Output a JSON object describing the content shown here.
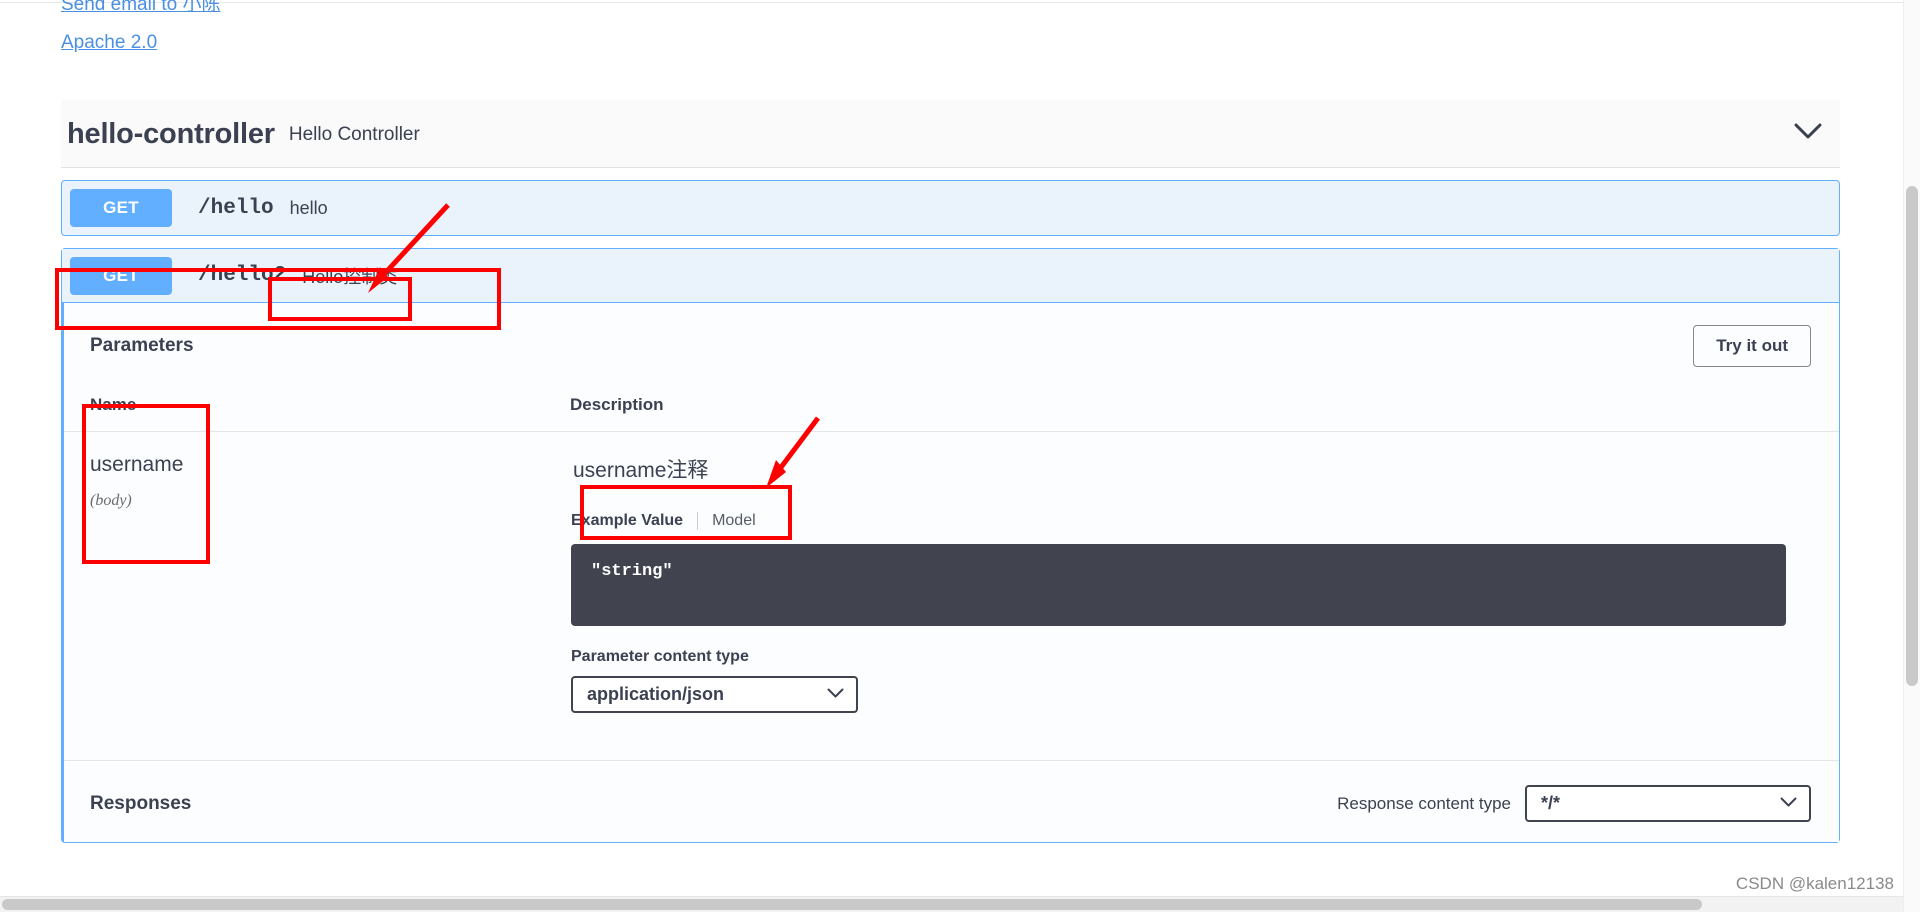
{
  "info": {
    "contact_link": "Send email to 小陈",
    "license_link": "Apache 2.0"
  },
  "tag": {
    "name": "hello-controller",
    "description": "Hello Controller",
    "collapse_icon": "chevron-down-icon"
  },
  "operations": [
    {
      "method": "GET",
      "path": "/hello",
      "summary": "hello",
      "expanded": false
    },
    {
      "method": "GET",
      "path": "/hello2",
      "summary": "Hello控制类",
      "expanded": true
    }
  ],
  "parameters_section": {
    "title": "Parameters",
    "try_it_out_label": "Try it out",
    "columns": {
      "name": "Name",
      "description": "Description"
    },
    "rows": [
      {
        "name": "username",
        "in": "(body)",
        "description": "username注释",
        "example_tab_label": "Example Value",
        "model_tab_label": "Model",
        "example_value": "\"string\"",
        "content_type_label": "Parameter content type",
        "content_type_value": "application/json"
      }
    ]
  },
  "responses_section": {
    "title": "Responses",
    "content_type_label": "Response content type",
    "content_type_value": "*/*"
  },
  "watermark": "CSDN @kalen12138",
  "colors": {
    "get_method": "#61affe",
    "annotation": "#fe0000",
    "code_background": "#41444e",
    "text": "#3b4151"
  }
}
